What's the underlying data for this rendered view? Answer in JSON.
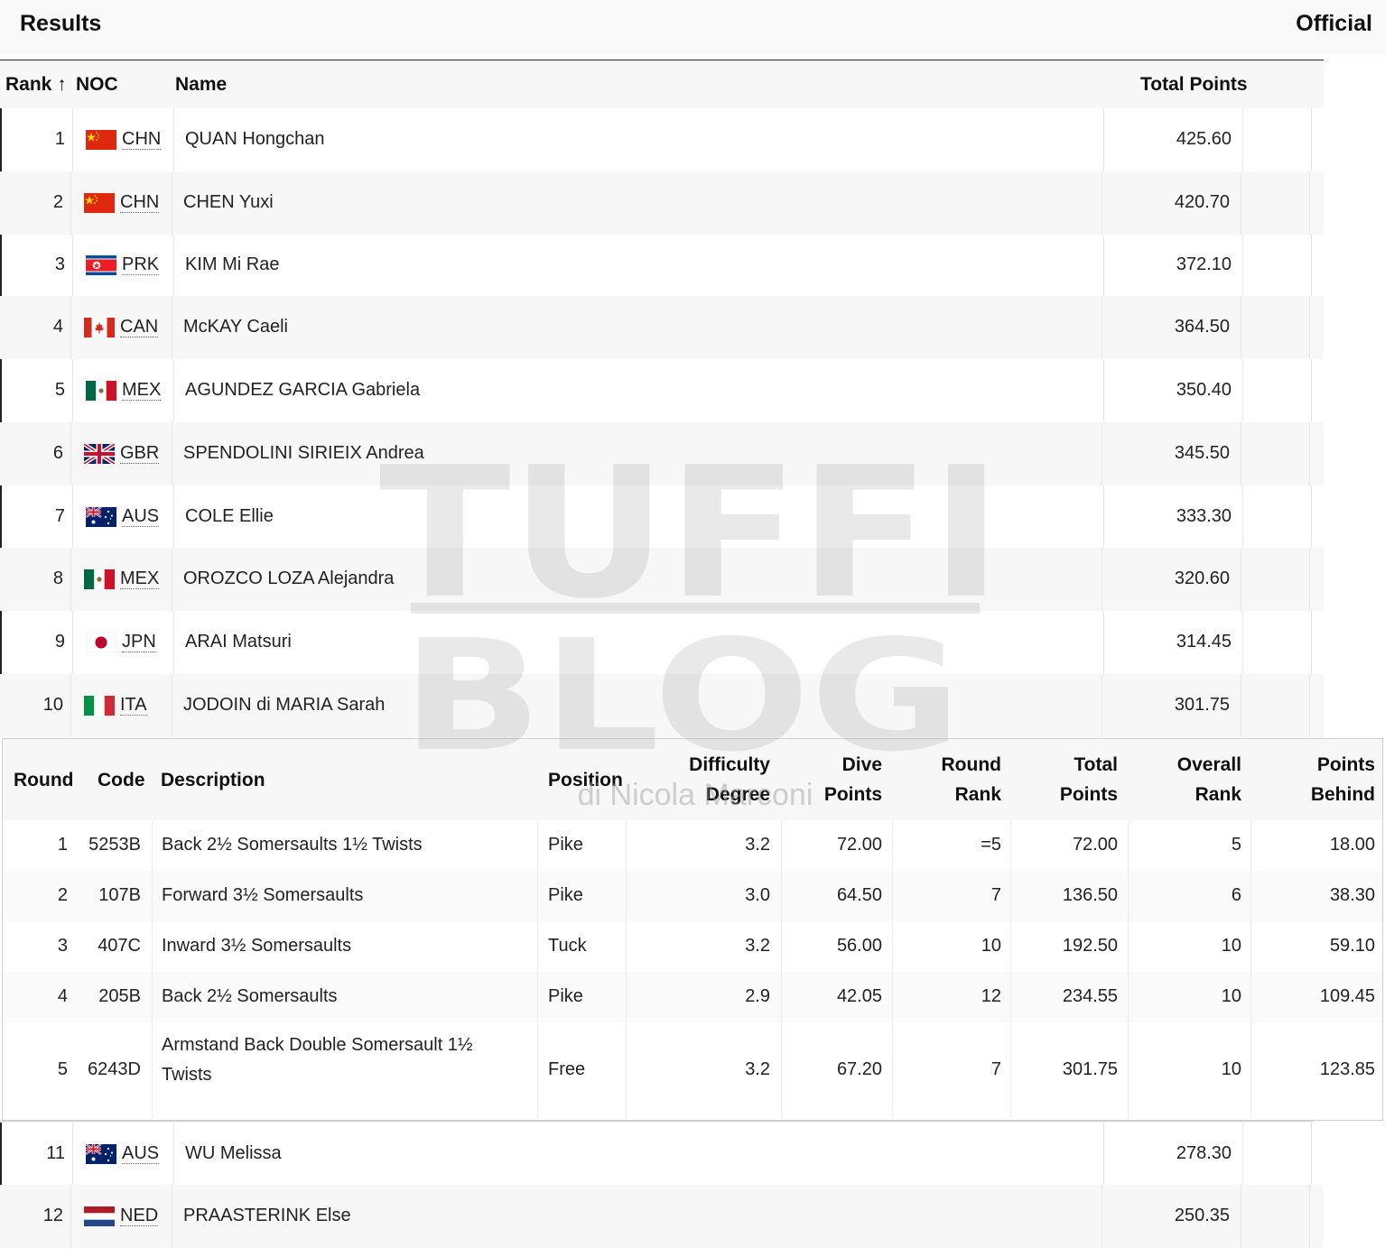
{
  "header": {
    "title": "Results",
    "status": "Official"
  },
  "columns": {
    "rank": "Rank",
    "sort_arrow": "↑",
    "noc": "NOC",
    "name": "Name",
    "total": "Total Points"
  },
  "athletes": [
    {
      "rank": "1",
      "noc": "CHN",
      "flag": "china",
      "name": "QUAN Hongchan",
      "points": "425.60"
    },
    {
      "rank": "2",
      "noc": "CHN",
      "flag": "china",
      "name": "CHEN Yuxi",
      "points": "420.70"
    },
    {
      "rank": "3",
      "noc": "PRK",
      "flag": "north-korea",
      "name": "KIM Mi Rae",
      "points": "372.10"
    },
    {
      "rank": "4",
      "noc": "CAN",
      "flag": "canada",
      "name": "McKAY Caeli",
      "points": "364.50"
    },
    {
      "rank": "5",
      "noc": "MEX",
      "flag": "mexico",
      "name": "AGUNDEZ GARCIA Gabriela",
      "points": "350.40"
    },
    {
      "rank": "6",
      "noc": "GBR",
      "flag": "great-britain",
      "name": "SPENDOLINI SIRIEIX Andrea",
      "points": "345.50"
    },
    {
      "rank": "7",
      "noc": "AUS",
      "flag": "australia",
      "name": "COLE Ellie",
      "points": "333.30"
    },
    {
      "rank": "8",
      "noc": "MEX",
      "flag": "mexico",
      "name": "OROZCO LOZA Alejandra",
      "points": "320.60"
    },
    {
      "rank": "9",
      "noc": "JPN",
      "flag": "japan",
      "name": "ARAI Matsuri",
      "points": "314.45"
    },
    {
      "rank": "10",
      "noc": "ITA",
      "flag": "italy",
      "name": "JODOIN di MARIA Sarah",
      "points": "301.75"
    },
    {
      "rank": "11",
      "noc": "AUS",
      "flag": "australia",
      "name": "WU Melissa",
      "points": "278.30"
    },
    {
      "rank": "12",
      "noc": "NED",
      "flag": "netherlands",
      "name": "PRAASTERINK Else",
      "points": "250.35"
    }
  ],
  "detail": {
    "headers": {
      "round": "Round",
      "code": "Code",
      "description": "Description",
      "position": "Position",
      "dd1": "Difficulty",
      "dd2": "Degree",
      "dp1": "Dive",
      "dp2": "Points",
      "rr1": "Round",
      "rr2": "Rank",
      "tp1": "Total",
      "tp2": "Points",
      "or1": "Overall",
      "or2": "Rank",
      "pb1": "Points",
      "pb2": "Behind"
    },
    "rows": [
      {
        "round": "1",
        "code": "5253B",
        "desc1": "Back 2½ Somersaults 1½ Twists",
        "desc2": "",
        "position": "Pike",
        "dd": "3.2",
        "dive_points": "72.00",
        "round_rank": "=5",
        "total": "72.00",
        "overall": "5",
        "behind": "18.00"
      },
      {
        "round": "2",
        "code": "107B",
        "desc1": "Forward 3½ Somersaults",
        "desc2": "",
        "position": "Pike",
        "dd": "3.0",
        "dive_points": "64.50",
        "round_rank": "7",
        "total": "136.50",
        "overall": "6",
        "behind": "38.30"
      },
      {
        "round": "3",
        "code": "407C",
        "desc1": "Inward 3½ Somersaults",
        "desc2": "",
        "position": "Tuck",
        "dd": "3.2",
        "dive_points": "56.00",
        "round_rank": "10",
        "total": "192.50",
        "overall": "10",
        "behind": "59.10"
      },
      {
        "round": "4",
        "code": "205B",
        "desc1": "Back 2½ Somersaults",
        "desc2": "",
        "position": "Pike",
        "dd": "2.9",
        "dive_points": "42.05",
        "round_rank": "12",
        "total": "234.55",
        "overall": "10",
        "behind": "109.45"
      },
      {
        "round": "5",
        "code": "6243D",
        "desc1": "Armstand Back Double Somersault 1½",
        "desc2": "Twists",
        "position": "Free",
        "dd": "3.2",
        "dive_points": "67.20",
        "round_rank": "7",
        "total": "301.75",
        "overall": "10",
        "behind": "123.85"
      }
    ]
  },
  "watermark": {
    "line1": "TUFFI",
    "line2": "BLOG",
    "byline": "di Nicola Marconi"
  }
}
